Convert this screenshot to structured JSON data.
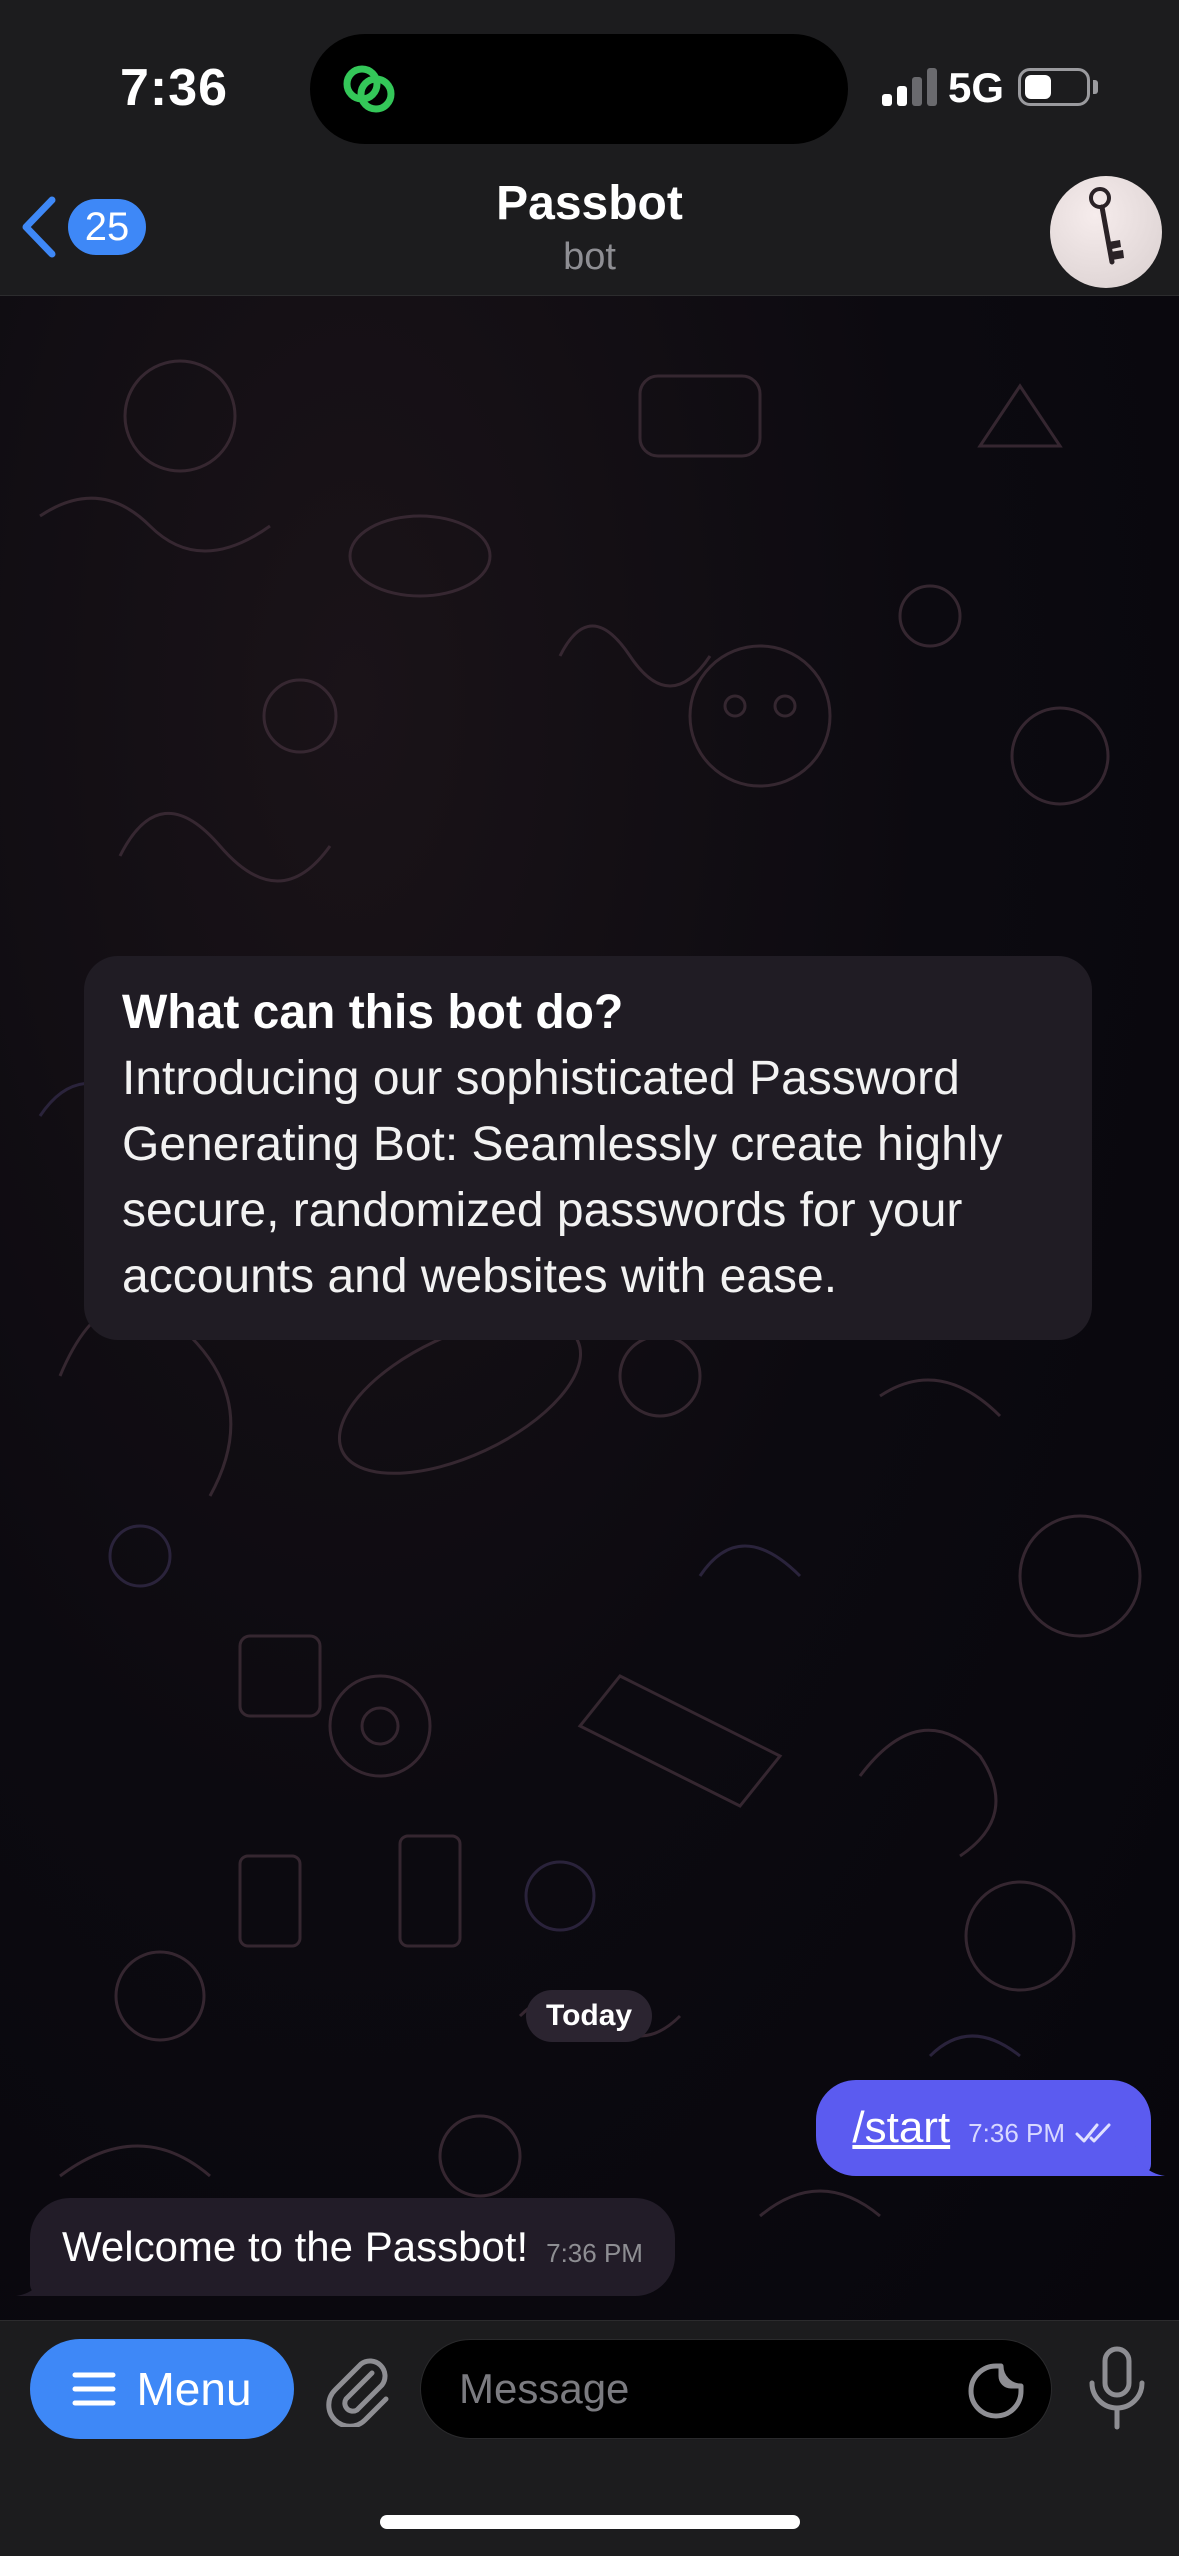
{
  "status_bar": {
    "time": "7:36",
    "network": "5G",
    "signal_bars_active": 2,
    "signal_bars_total": 4,
    "battery_level": 0.3
  },
  "header": {
    "back_badge_count": "25",
    "title": "Passbot",
    "subtitle": "bot"
  },
  "intro_card": {
    "title": "What can this bot do?",
    "body": "Introducing our sophisticated Password Generating Bot: Seamlessly create highly secure, randomized passwords for your accounts and websites with ease."
  },
  "date_separator": "Today",
  "messages": [
    {
      "direction": "outgoing",
      "text": "/start",
      "time": "7:36 PM",
      "status": "read"
    },
    {
      "direction": "incoming",
      "text": "Welcome to the Passbot!",
      "time": "7:36 PM"
    }
  ],
  "input_bar": {
    "menu_label": "Menu",
    "placeholder": "Message"
  },
  "colors": {
    "accent_blue": "#3e88f7",
    "outgoing_bubble": "#5b5bf0",
    "incoming_bubble": "#221c28",
    "bar_background": "#1c1c1e",
    "island_icon_green": "#34c759"
  },
  "icons": {
    "island": "link-rings-icon",
    "back": "chevron-left-icon",
    "avatar": "key-icon",
    "menu": "hamburger-icon",
    "attach": "paperclip-icon",
    "sticker": "sticker-icon",
    "voice": "microphone-icon",
    "read_receipt": "double-check-icon"
  }
}
